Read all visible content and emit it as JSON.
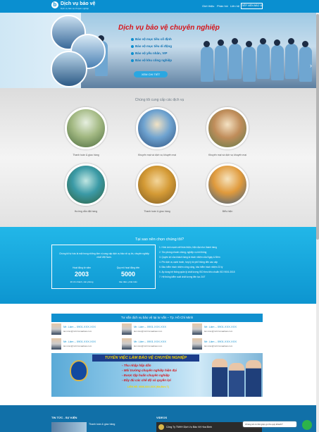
{
  "header": {
    "logo_letter": "b",
    "logo_text": "Dịch vụ bảo vệ",
    "logo_sub": "Dịch vụ bảo vệ chuyên nghiệp",
    "nav": [
      "Giới thiệu",
      "Phản hồi",
      "Liên hệ"
    ],
    "cta_label": "TIẾP VIÊN BẢO VỆ"
  },
  "banner": {
    "title": "Dịch vụ bảo vệ chuyên nghiệp",
    "items": [
      "Bảo vệ mục tiêu cố định",
      "Bảo vệ mục tiêu di động",
      "Bảo vệ yếu nhân, VIP",
      "Bảo vệ khu công nghiệp"
    ],
    "button": "XEM CHI TIẾT",
    "arrow": "›"
  },
  "services": {
    "title": "Chúng tôi cung cấp các dịch vụ",
    "items": [
      {
        "caption": "Thanh toán & giao hàng"
      },
      {
        "caption": "Khuyến mại và dịch vụ khuyến mại"
      },
      {
        "caption": "Khuyến mại và dịch vụ khuyến mại"
      },
      {
        "caption": "Hướng dẫn đặt hàng"
      },
      {
        "caption": "Thanh toán & giao hàng"
      },
      {
        "caption": "Biểu hiện"
      }
    ]
  },
  "why": {
    "title": "Tại sao nên chọn chúng tôi?",
    "description": "Chúng tôi tự hào là một trong những đơn vị cung cấp dịch vụ bảo vệ uy tín, chuyên nghiệp nhất Việt Nam.",
    "stats": [
      {
        "label": "Hoạt động từ năm",
        "value": "2003",
        "sub": "20 chi nhánh, văn phòng"
      },
      {
        "label": "Quy mô hoạt động trên",
        "value": "5000",
        "sub": "bảo đảm, phát triển"
      }
    ],
    "reasons": [
      "1. Hình ảnh mạnh mẽ thân thiện, hiện đại như thành hàng",
      "2. Tốc phòng nhanh chóng, nghiệp vụ khi thông",
      "3. Quyền lợi của khách hàng là trách nhiệm của Ngày & Đêm",
      "4. Phí dịch vụ cạnh tranh, hợp lý từ phổ thông đến cao cấp",
      "5. Bảo hiểm trách nhiệm công cộng, bảo hiểm trách nhiệm 23 tỷ",
      "6. Áp dụng hệ thống quản lý chất lượng ISO theo tiêu chuẩn ISO 9001:2015",
      "7. Hệ thống kiểm soát chất lượng liên tục 24/7"
    ]
  },
  "consult": {
    "title": "Tư vấn dịch vụ bảo vệ tại tư vấn – Tp. Hồ Chí Minh",
    "contacts": [
      {
        "name": "Mr. Lâm – 0901.XXX.XXX",
        "email": "lam.tran@mrtrimmaabasi.com"
      },
      {
        "name": "Mr. Lâm – 0901.XXX.XXX",
        "email": "lam.tran@mrtrimmaabasi.com"
      },
      {
        "name": "Mr. Lâm – 0901.XXX.XXX",
        "email": "lam.tran@mrtrimmaabasi.com"
      },
      {
        "name": "Mr. Lâm – 0901.XXX.XXX",
        "email": "lam.tran@mrtrimmaabasi.com"
      },
      {
        "name": "Mr. Lâm – 0901.XXX.XXX",
        "email": "lam.tran@mrtrimmaabasi.com"
      },
      {
        "name": "Mr. Lâm – 0901.XXX.XXX",
        "email": "lam.tran@mrtrimmaabasi.com"
      }
    ]
  },
  "recruit": {
    "title": "TUYỂN VIỆC LÀM BẢO VỆ CHUYÊN NGHIỆP",
    "items": [
      "- Thu nhập hấp dẫn",
      "- Môi trường chuyên nghiệp hiện đại",
      "- Được tập huấn chuyên nghiệp",
      "- Đầy đủ các chế độ và quyền lợi"
    ],
    "phone": "LIÊN HỆ: 0906.XXX.XXX (Ms.Đức T)"
  },
  "footer": {
    "news_heading": "TIN TỨC - SỰ KIỆN",
    "news_title": "Thanh toán & giao hàng",
    "video_heading": "VIDEOS",
    "video_label": "Công Ty TNHH Dịch Vụ Bảo Vệ Hòa Bình"
  },
  "chat": {
    "label": "Chúng tôi có thể giúp gì cho quý khách?"
  },
  "colors": {
    "primary": "#0a8fd0",
    "accent_red": "#d6151b",
    "why_bg": "#1aa9e0"
  }
}
